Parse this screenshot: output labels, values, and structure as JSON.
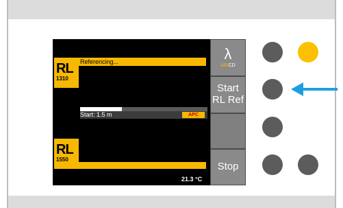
{
  "screen": {
    "header_label": "Referencing...",
    "channel_top": {
      "name": "RL",
      "wavelength": "1310"
    },
    "channel_bottom": {
      "name": "RL",
      "wavelength": "1550"
    },
    "status_text": "Start: 1.5 m",
    "apc_badge": "APC",
    "progress_fraction": 0.33,
    "temperature": "21.3 °C"
  },
  "softkeys": {
    "lambda_symbol": "λ",
    "lambda_sub_ab": "AB/",
    "lambda_sub_cd": "CD",
    "start_line1": "Start",
    "start_line2": "RL Ref",
    "stop": "Stop"
  },
  "colors": {
    "accent_yellow": "#f6b800",
    "led_yellow": "#fcc100",
    "arrow_blue": "#1e9ee2",
    "button_gray": "#5c5c5c"
  }
}
